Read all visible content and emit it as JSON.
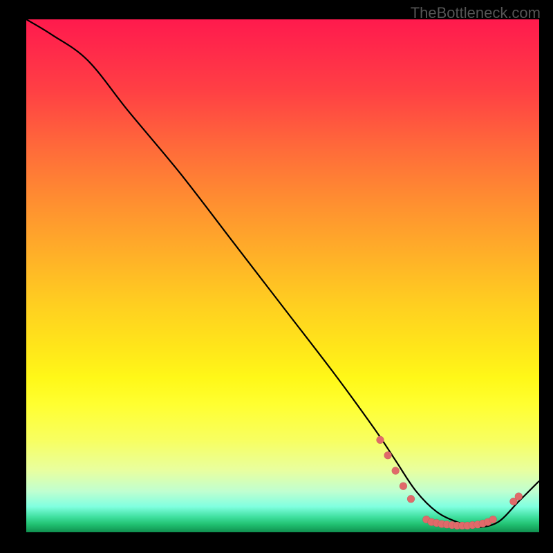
{
  "watermark": "TheBottleneck.com",
  "chart_data": {
    "type": "line",
    "title": "",
    "xlabel": "",
    "ylabel": "",
    "xlim": [
      0,
      100
    ],
    "ylim": [
      0,
      100
    ],
    "series": [
      {
        "name": "curve",
        "x": [
          0,
          5,
          12,
          20,
          30,
          40,
          50,
          60,
          68,
          72,
          76,
          80,
          84,
          88,
          92,
          96,
          100
        ],
        "y": [
          100,
          97,
          92,
          82,
          70,
          57,
          44,
          31,
          20,
          14,
          8,
          4,
          2,
          1,
          2,
          6,
          10
        ]
      }
    ],
    "markers": [
      {
        "x": 69,
        "y": 18
      },
      {
        "x": 70.5,
        "y": 15
      },
      {
        "x": 72,
        "y": 12
      },
      {
        "x": 73.5,
        "y": 9
      },
      {
        "x": 75,
        "y": 6.5
      },
      {
        "x": 78,
        "y": 2.5
      },
      {
        "x": 79,
        "y": 2
      },
      {
        "x": 80,
        "y": 1.8
      },
      {
        "x": 81,
        "y": 1.6
      },
      {
        "x": 82,
        "y": 1.5
      },
      {
        "x": 83,
        "y": 1.4
      },
      {
        "x": 84,
        "y": 1.3
      },
      {
        "x": 85,
        "y": 1.3
      },
      {
        "x": 86,
        "y": 1.3
      },
      {
        "x": 87,
        "y": 1.4
      },
      {
        "x": 88,
        "y": 1.5
      },
      {
        "x": 89,
        "y": 1.7
      },
      {
        "x": 90,
        "y": 2
      },
      {
        "x": 91,
        "y": 2.5
      },
      {
        "x": 95,
        "y": 6
      },
      {
        "x": 96,
        "y": 7
      }
    ],
    "gradient_stops": [
      {
        "pos": 0,
        "color": "#ff1a4d"
      },
      {
        "pos": 25,
        "color": "#ff6a3a"
      },
      {
        "pos": 50,
        "color": "#ffd020"
      },
      {
        "pos": 75,
        "color": "#ffff30"
      },
      {
        "pos": 95,
        "color": "#80ffe0"
      },
      {
        "pos": 100,
        "color": "#109050"
      }
    ]
  }
}
